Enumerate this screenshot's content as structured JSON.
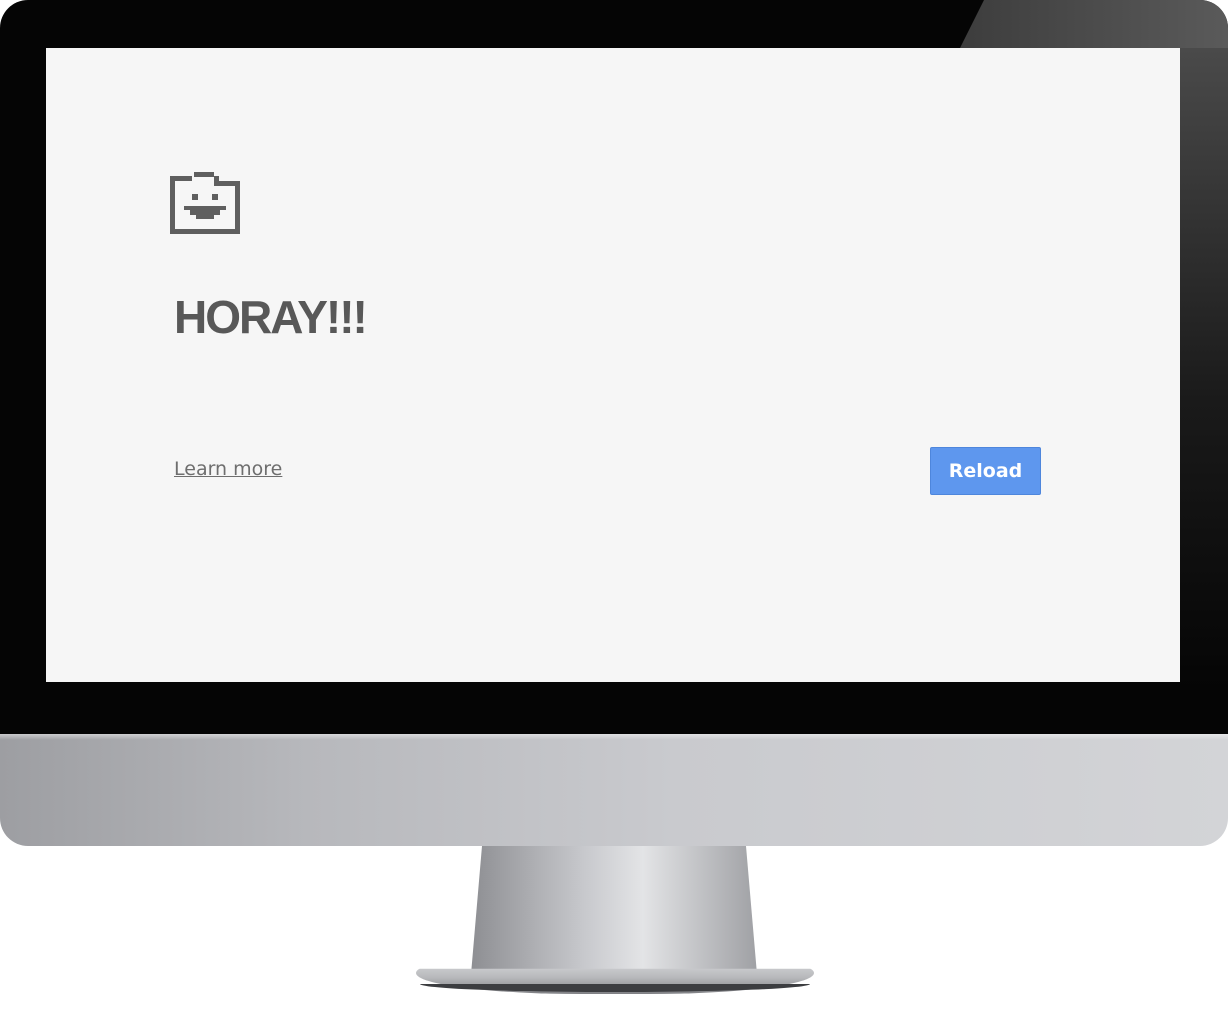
{
  "screen": {
    "icon": "smiling-folder-icon",
    "headline": "HORAY!!!",
    "learn_more_label": "Learn more",
    "reload_label": "Reload"
  },
  "colors": {
    "screen_background": "#f6f6f6",
    "headline_text": "#585858",
    "reload_button": "#5e97ee",
    "bezel": "#050505",
    "chin": "#c9cace"
  }
}
